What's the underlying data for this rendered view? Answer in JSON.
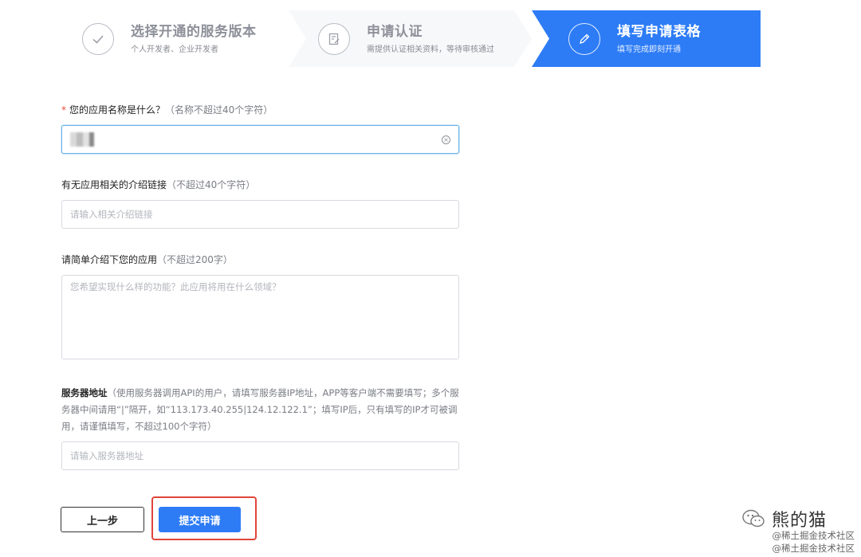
{
  "steps": [
    {
      "title": "选择开通的服务版本",
      "subtitle": "个人开发者、企业开发者",
      "icon": "check-icon",
      "state": "done"
    },
    {
      "title": "申请认证",
      "subtitle": "需提供认证相关资料，等待审核通过",
      "icon": "document-edit-icon",
      "state": "done"
    },
    {
      "title": "填写申请表格",
      "subtitle": "填写完成即刻开通",
      "icon": "pencil-icon",
      "state": "active"
    }
  ],
  "form": {
    "app_name": {
      "required_mark": "*",
      "label": "您的应用名称是什么？",
      "hint": "（名称不超过40个字符）"
    },
    "intro_link": {
      "label": "有无应用相关的介绍链接",
      "hint": "（不超过40个字符）",
      "placeholder": "请输入相关介绍链接"
    },
    "description": {
      "label": "请简单介绍下您的应用",
      "hint": "（不超过200字）",
      "placeholder": "您希望实现什么样的功能？此应用将用在什么领域？"
    },
    "server": {
      "label": "服务器地址",
      "hint": "（使用服务器调用API的用户，请填写服务器IP地址，APP等客户端不需要填写；多个服务器中间请用“|”隔开，如“113.173.40.255|124.12.122.1”；填写IP后，只有填写的IP才可被调用，请谨慎填写，不超过100个字符）",
      "placeholder": "请输入服务器地址"
    }
  },
  "buttons": {
    "prev": "上一步",
    "submit": "提交申请"
  },
  "watermark": {
    "brand": "熊的猫",
    "line1": "@稀土掘金技术社区",
    "line2": "@稀土掘金技术社区"
  },
  "colors": {
    "accent": "#2d7cf6",
    "required": "#e84a3c",
    "highlight": "#e0453a"
  }
}
